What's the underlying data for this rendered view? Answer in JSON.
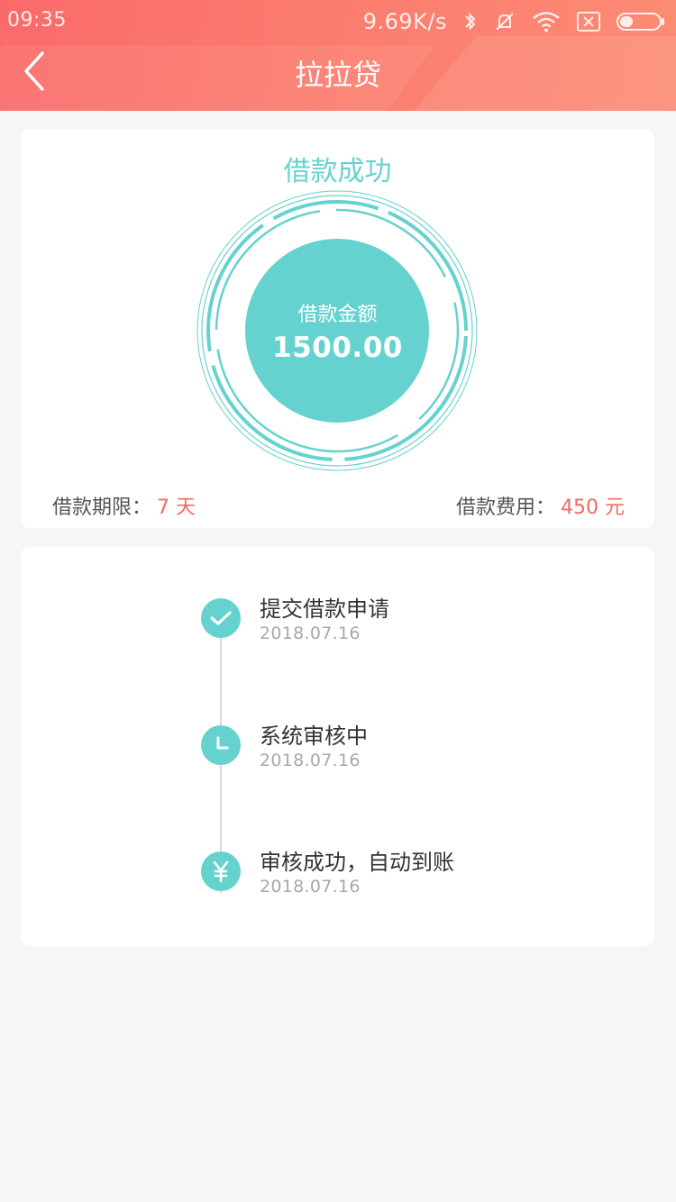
{
  "status_bar": {
    "time": "09:35",
    "net_speed": "9.69K/s",
    "icons": [
      "bluetooth-icon",
      "mute-icon",
      "wifi-icon",
      "no-sim-icon",
      "battery-icon"
    ]
  },
  "header": {
    "title": "拉拉贷",
    "back_icon": "chevron-left-icon"
  },
  "summary": {
    "status_title": "借款成功",
    "amount_label": "借款金额",
    "amount": "1500.00",
    "term_label": "借款期限：",
    "term_value": "7 天",
    "fee_label": "借款费用：",
    "fee_value": "450 元"
  },
  "timeline": {
    "steps": [
      {
        "title": "提交借款申请",
        "date": "2018.07.16",
        "icon": "check-icon"
      },
      {
        "title": "系统审核中",
        "date": "2018.07.16",
        "icon": "clock-icon"
      },
      {
        "title": "审核成功，自动到账",
        "date": "2018.07.16",
        "icon": "yuan-icon"
      }
    ]
  },
  "colors": {
    "header_start": "#fa6a6a",
    "header_end": "#fc8c74",
    "accent_teal": "#66d2cf",
    "highlight_red": "#f16b62",
    "background": "#f6f6f6"
  }
}
